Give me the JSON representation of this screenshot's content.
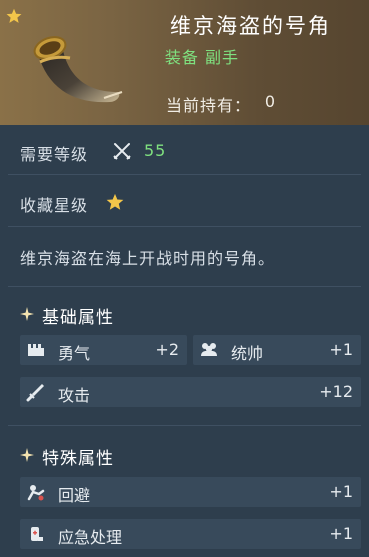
{
  "item": {
    "name": "维京海盗的号角",
    "type": "装备 副手",
    "owned_label": "当前持有：",
    "owned_count": "0",
    "description": "维京海盗在海上开战时用的号角。"
  },
  "requirements": {
    "level_label": "需要等级",
    "level_value": "55",
    "star_label": "收藏星级",
    "icon": "crossed-swords-icon"
  },
  "basic_section": {
    "title": "基础属性",
    "stats": [
      {
        "name": "勇气",
        "value": "+2",
        "icon": "courage-icon"
      },
      {
        "name": "统帅",
        "value": "+1",
        "icon": "leadership-icon"
      },
      {
        "name": "攻击",
        "value": "+12",
        "icon": "sword-icon"
      }
    ]
  },
  "special_section": {
    "title": "特殊属性",
    "stats": [
      {
        "name": "回避",
        "value": "+1",
        "icon": "dodge-icon"
      },
      {
        "name": "应急处理",
        "value": "+1",
        "icon": "first-aid-icon"
      }
    ]
  },
  "colors": {
    "header_gold": "#8a7148",
    "panel": "#2e3e4d",
    "stat_box": "#384a5b",
    "green": "#7fe07f",
    "star_gold": "#f3c64a"
  }
}
